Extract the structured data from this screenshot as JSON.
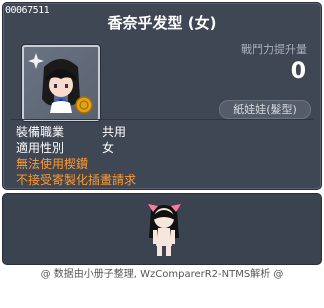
{
  "item": {
    "id": "00067511",
    "name": "香奈乎发型 (女)",
    "stat_label": "戰鬥力提升量",
    "stat_value": "0",
    "category": "紙娃娃(髮型)"
  },
  "requirements": [
    {
      "label": "裝備職業",
      "value": "共用"
    },
    {
      "label": "適用性別",
      "value": "女"
    }
  ],
  "warnings": [
    "無法使用楔鑽",
    "不接受寄製化插畫請求"
  ],
  "footer": "@ 数据由小册子整理, WzComparerR2-NTMS解析 @",
  "colors": {
    "panel_bg": "#3f4654",
    "warning_text": "#ff9a2e",
    "secondary_text": "#a9b0bc"
  }
}
